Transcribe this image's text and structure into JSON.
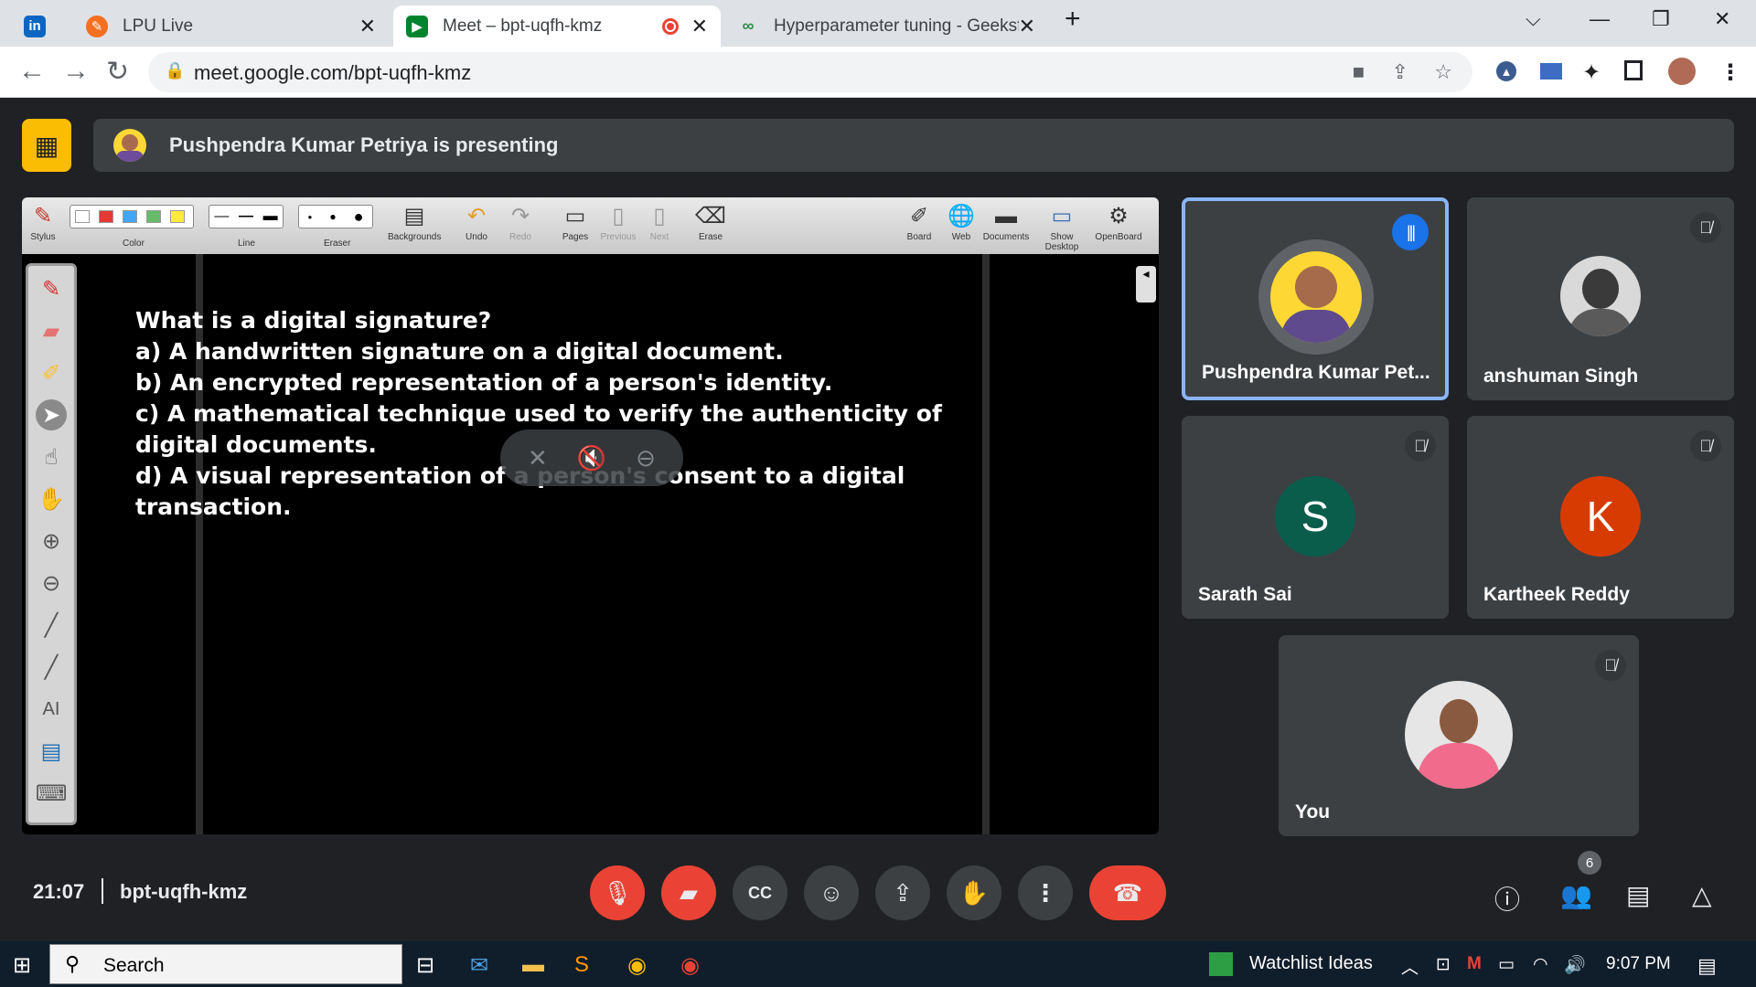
{
  "browser": {
    "tabs": [
      {
        "label": "",
        "icon": "linkedin-icon"
      },
      {
        "label": "LPU Live",
        "icon": "lpu-icon"
      },
      {
        "label": "Meet – bpt-uqfh-kmz",
        "icon": "meet-icon",
        "active": true
      },
      {
        "label": "Hyperparameter tuning - Geeksfc",
        "icon": "gfg-icon"
      }
    ],
    "url": "meet.google.com/bpt-uqfh-kmz"
  },
  "presenting": {
    "text": "Pushpendra Kumar Petriya is presenting"
  },
  "openboard": {
    "toolbar": [
      "Stylus",
      "Color",
      "Line",
      "Eraser",
      "Backgrounds",
      "Undo",
      "Redo",
      "Pages",
      "Previous",
      "Next",
      "Erase",
      "Board",
      "Web",
      "Documents",
      "Show Desktop",
      "OpenBoard"
    ],
    "question": [
      "What is a digital signature?",
      "a) A handwritten signature on a digital document.",
      "b) An encrypted representation of a person's identity.",
      "c) A mathematical technique used to verify the authenticity of",
      "digital documents.",
      "d) A visual representation of a person's consent to a digital",
      "transaction."
    ]
  },
  "participants": [
    {
      "name": "Pushpendra Kumar Pet...",
      "speaking": true
    },
    {
      "name": "anshuman Singh",
      "muted": true
    },
    {
      "name": "Sarath Sai",
      "initial": "S",
      "color": "#0b5d4b",
      "muted": true
    },
    {
      "name": "Kartheek Reddy",
      "initial": "K",
      "color": "#d83b01",
      "muted": true
    },
    {
      "name": "You",
      "muted": true
    }
  ],
  "meeting": {
    "time": "21:07",
    "code": "bpt-uqfh-kmz",
    "participant_count": "6"
  },
  "taskbar": {
    "search": "Search",
    "widget": "Watchlist Ideas",
    "clock": "9:07 PM"
  },
  "colors": {
    "meet_bg": "#202124",
    "tile_bg": "#3c4043",
    "red": "#ea4335",
    "active_border": "#8ab4f8",
    "present_yellow": "#fbbc04"
  }
}
